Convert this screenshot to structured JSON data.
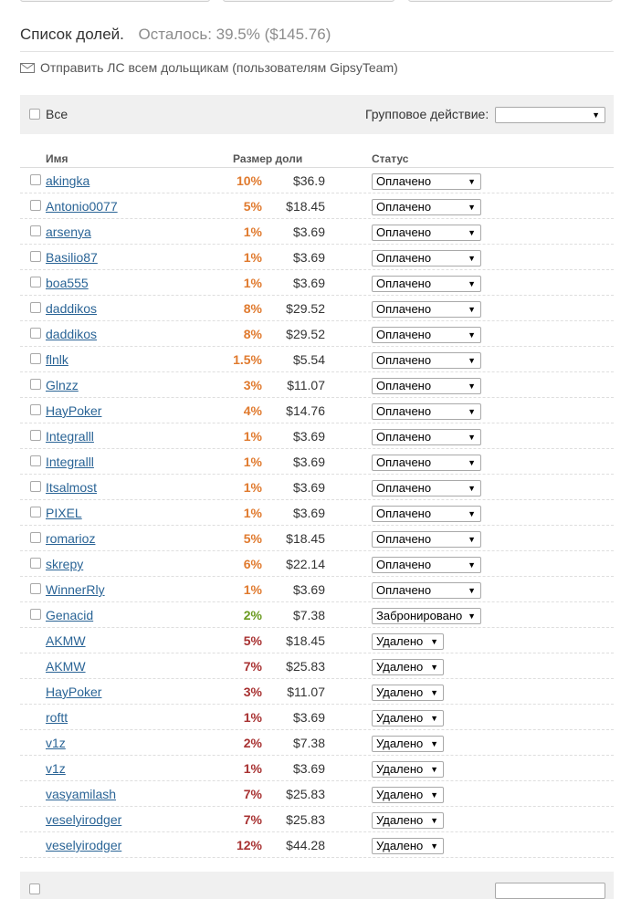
{
  "header": {
    "title": "Список долей.",
    "remaining": "Осталось: 39.5% ($145.76)"
  },
  "pm_link": "Отправить ЛС всем дольщикам (пользователям GipsyTeam)",
  "toolbar": {
    "all_label": "Все",
    "group_action_label": "Групповое действие:",
    "group_action_value": ""
  },
  "columns": {
    "name": "Имя",
    "share": "Размер доли",
    "status": "Статус"
  },
  "colors": {
    "paid": "#e07a2e",
    "reserved": "#6a9a1f",
    "deleted": "#a83232",
    "link": "#2a6496"
  },
  "rows": [
    {
      "name": "akingka",
      "pct": "10%",
      "amount": "$36.9",
      "status": "Оплачено",
      "kind": "paid"
    },
    {
      "name": "Antonio0077",
      "pct": "5%",
      "amount": "$18.45",
      "status": "Оплачено",
      "kind": "paid"
    },
    {
      "name": "arsenya",
      "pct": "1%",
      "amount": "$3.69",
      "status": "Оплачено",
      "kind": "paid"
    },
    {
      "name": "Basilio87",
      "pct": "1%",
      "amount": "$3.69",
      "status": "Оплачено",
      "kind": "paid"
    },
    {
      "name": "boa555",
      "pct": "1%",
      "amount": "$3.69",
      "status": "Оплачено",
      "kind": "paid"
    },
    {
      "name": "daddikos",
      "pct": "8%",
      "amount": "$29.52",
      "status": "Оплачено",
      "kind": "paid"
    },
    {
      "name": "daddikos",
      "pct": "8%",
      "amount": "$29.52",
      "status": "Оплачено",
      "kind": "paid"
    },
    {
      "name": "flnlk",
      "pct": "1.5%",
      "amount": "$5.54",
      "status": "Оплачено",
      "kind": "paid"
    },
    {
      "name": "Glnzz",
      "pct": "3%",
      "amount": "$11.07",
      "status": "Оплачено",
      "kind": "paid"
    },
    {
      "name": "HayPoker",
      "pct": "4%",
      "amount": "$14.76",
      "status": "Оплачено",
      "kind": "paid"
    },
    {
      "name": "Integralll",
      "pct": "1%",
      "amount": "$3.69",
      "status": "Оплачено",
      "kind": "paid"
    },
    {
      "name": "Integralll",
      "pct": "1%",
      "amount": "$3.69",
      "status": "Оплачено",
      "kind": "paid"
    },
    {
      "name": "Itsalmost",
      "pct": "1%",
      "amount": "$3.69",
      "status": "Оплачено",
      "kind": "paid"
    },
    {
      "name": "PIXEL",
      "pct": "1%",
      "amount": "$3.69",
      "status": "Оплачено",
      "kind": "paid"
    },
    {
      "name": "romarioz",
      "pct": "5%",
      "amount": "$18.45",
      "status": "Оплачено",
      "kind": "paid"
    },
    {
      "name": "skrepy",
      "pct": "6%",
      "amount": "$22.14",
      "status": "Оплачено",
      "kind": "paid"
    },
    {
      "name": "WinnerRly",
      "pct": "1%",
      "amount": "$3.69",
      "status": "Оплачено",
      "kind": "paid"
    },
    {
      "name": "Genacid",
      "pct": "2%",
      "amount": "$7.38",
      "status": "Забронировано",
      "kind": "reserved"
    },
    {
      "name": "AKMW",
      "pct": "5%",
      "amount": "$18.45",
      "status": "Удалено",
      "kind": "deleted"
    },
    {
      "name": "AKMW",
      "pct": "7%",
      "amount": "$25.83",
      "status": "Удалено",
      "kind": "deleted"
    },
    {
      "name": "HayPoker",
      "pct": "3%",
      "amount": "$11.07",
      "status": "Удалено",
      "kind": "deleted"
    },
    {
      "name": "roftt",
      "pct": "1%",
      "amount": "$3.69",
      "status": "Удалено",
      "kind": "deleted"
    },
    {
      "name": "v1z",
      "pct": "2%",
      "amount": "$7.38",
      "status": "Удалено",
      "kind": "deleted"
    },
    {
      "name": "v1z",
      "pct": "1%",
      "amount": "$3.69",
      "status": "Удалено",
      "kind": "deleted"
    },
    {
      "name": "vasyamilash",
      "pct": "7%",
      "amount": "$25.83",
      "status": "Удалено",
      "kind": "deleted"
    },
    {
      "name": "veselyirodger",
      "pct": "7%",
      "amount": "$25.83",
      "status": "Удалено",
      "kind": "deleted"
    },
    {
      "name": "veselyirodger",
      "pct": "12%",
      "amount": "$44.28",
      "status": "Удалено",
      "kind": "deleted"
    }
  ]
}
